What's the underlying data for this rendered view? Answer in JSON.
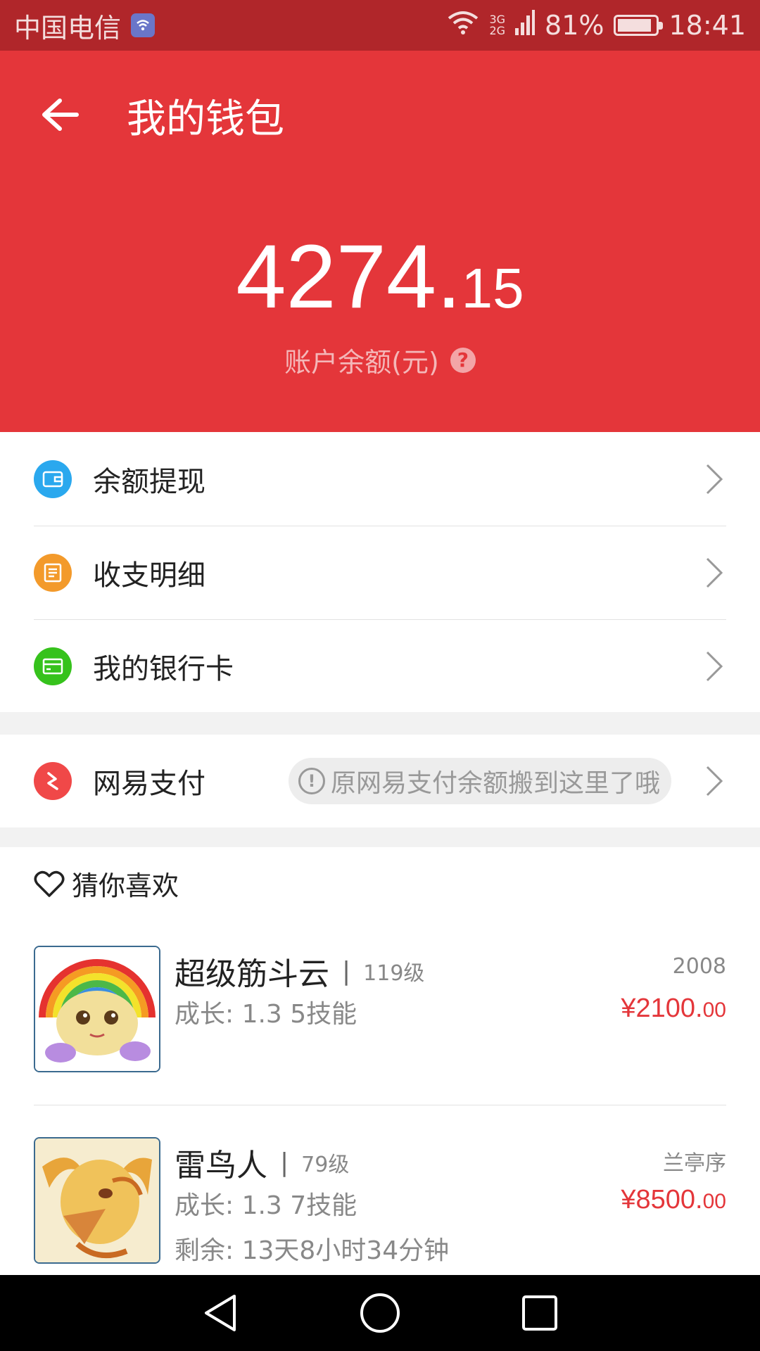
{
  "status_bar": {
    "carrier": "中国电信",
    "network_top": "3G",
    "network_bottom": "2G",
    "battery_percent_text": "81%",
    "battery_level": 0.81,
    "time": "18:41"
  },
  "header": {
    "title": "我的钱包",
    "balance_integer": "4274.",
    "balance_decimal": "15",
    "balance_label": "账户余额(元)",
    "help_glyph": "?",
    "background_color": "#e4363a"
  },
  "menu": {
    "items": [
      {
        "label": "余额提现",
        "icon": "wallet-icon",
        "color": "#2aa8ee"
      },
      {
        "label": "收支明细",
        "icon": "list-icon",
        "color": "#f39a2b"
      },
      {
        "label": "我的银行卡",
        "icon": "bank-card-icon",
        "color": "#36c21c"
      }
    ]
  },
  "netease_pay": {
    "label": "网易支付",
    "icon": "netease-pay-icon",
    "color": "#f04848",
    "notice_icon_glyph": "!",
    "notice": "原网易支付余额搬到这里了哦"
  },
  "recommend": {
    "title": "猜你喜欢",
    "products": [
      {
        "name": "超级筋斗云",
        "separator": "|",
        "level": "119级",
        "server": "2008",
        "specs": "成长: 1.3  5技能",
        "price_main": "¥2100.",
        "price_cents": "00",
        "remaining": ""
      },
      {
        "name": "雷鸟人",
        "separator": "|",
        "level": "79级",
        "server": "兰亭序",
        "specs": "成长: 1.3  7技能",
        "price_main": "¥8500.",
        "price_cents": "00",
        "remaining": "剩余:  13天8小时34分钟"
      }
    ]
  },
  "navigation": [
    "back-nav-icon",
    "home-nav-icon",
    "recents-nav-icon"
  ]
}
